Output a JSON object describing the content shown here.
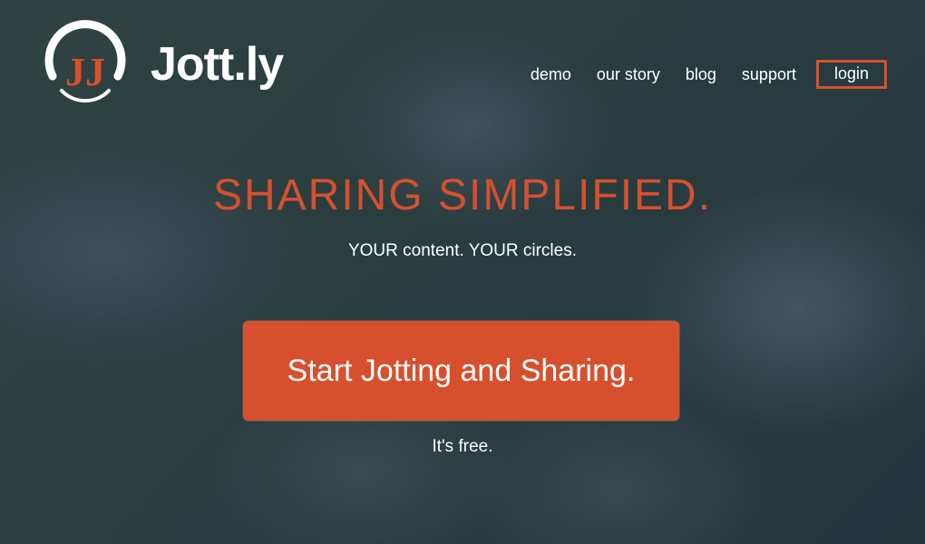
{
  "brand": {
    "name": "Jott.ly",
    "logo_letters": "JJ",
    "accent_color": "#d6502e"
  },
  "nav": {
    "items": [
      {
        "label": "demo"
      },
      {
        "label": "our story"
      },
      {
        "label": "blog"
      },
      {
        "label": "support"
      }
    ],
    "login_label": "login"
  },
  "hero": {
    "headline": "SHARING SIMPLIFIED.",
    "tagline": "YOUR content. YOUR circles.",
    "cta_label": "Start Jotting and Sharing.",
    "subtext": "It's free."
  }
}
